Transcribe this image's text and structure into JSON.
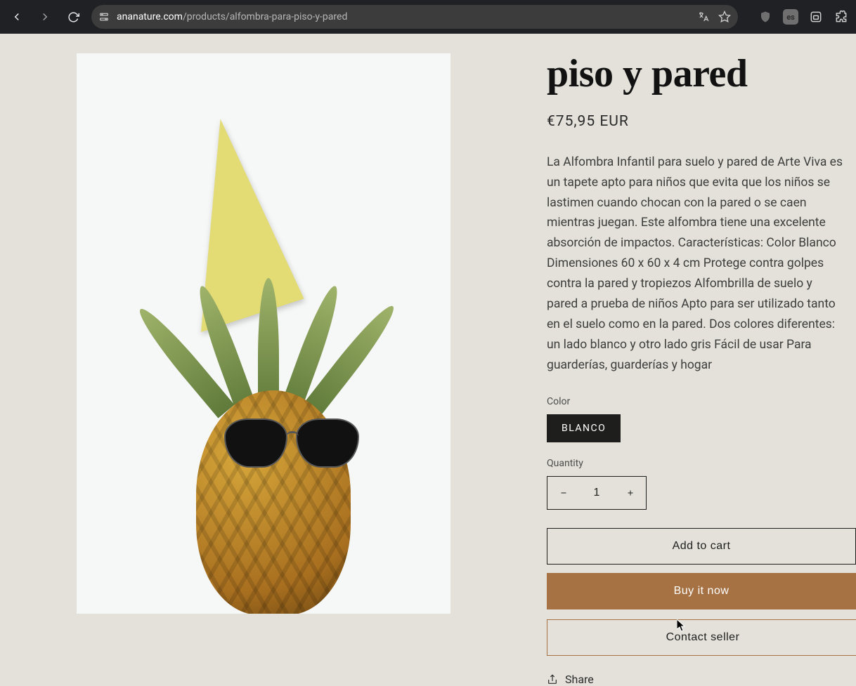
{
  "browser": {
    "url_domain": "ananature.com",
    "url_path": "/products/alfombra-para-piso-y-pared"
  },
  "product": {
    "title": "piso y pared",
    "price": "€75,95 EUR",
    "description": "La Alfombra Infantil para suelo y pared de Arte Viva es un tapete apto para niños que evita que los niños se lastimen cuando chocan con la pared o se caen mientras juegan. Este alfombra tiene una excelente absorción de impactos. Características: Color Blanco Dimensiones 60 x 60 x 4 cm Protege contra golpes contra la pared y tropiezos Alfombrilla de suelo y pared a prueba de niños Apto para ser utilizado tanto en el suelo como en la pared. Dos colores diferentes: un lado blanco y otro lado gris Fácil de usar Para guarderías, guarderías y hogar",
    "variant_label": "Color",
    "variant_option": "BLANCO",
    "quantity_label": "Quantity",
    "quantity_value": "1",
    "add_to_cart": "Add to cart",
    "buy_now": "Buy it now",
    "contact_seller": "Contact seller",
    "share": "Share"
  },
  "colors": {
    "accent": "#a77243",
    "ink": "#1e1e1d",
    "page_bg": "#e3e1da"
  }
}
